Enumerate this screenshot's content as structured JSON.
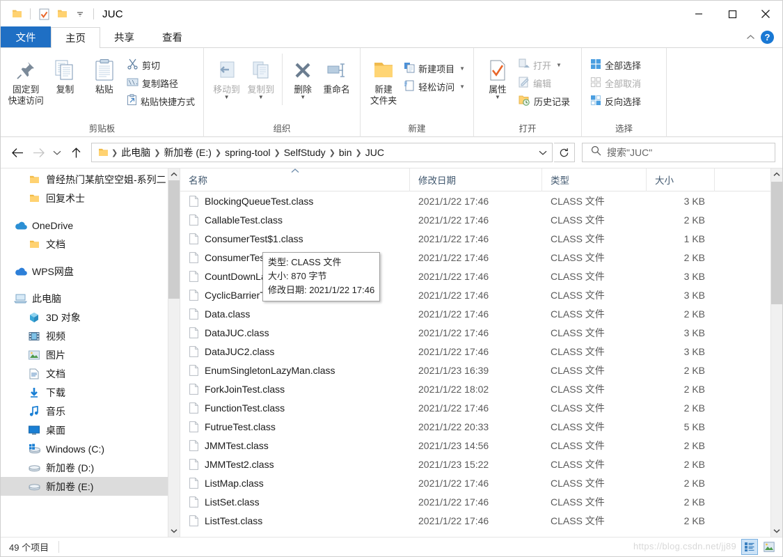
{
  "window": {
    "title": "JUC",
    "quick_access": [
      "folder-icon",
      "properties-check-icon",
      "new-folder-icon",
      "customize-dropdown-icon"
    ],
    "controls": {
      "minimize": "minimize-icon",
      "maximize": "maximize-icon",
      "close": "close-icon"
    }
  },
  "tabs": {
    "file": "文件",
    "items": [
      {
        "label": "主页",
        "active": true
      },
      {
        "label": "共享",
        "active": false
      },
      {
        "label": "查看",
        "active": false
      }
    ],
    "collapse_icon": "chevron-up-icon",
    "help_icon": "help-icon"
  },
  "ribbon": {
    "groups": [
      {
        "label": "剪贴板",
        "big": [
          {
            "label": "固定到\n快速访问",
            "line1": "固定到",
            "line2": "快速访问",
            "icon": "pin-icon"
          },
          {
            "label": "复制",
            "icon": "copy-icon"
          },
          {
            "label": "粘贴",
            "icon": "paste-icon"
          }
        ],
        "small": [
          {
            "label": "剪切",
            "icon": "scissors-icon",
            "dim": false
          },
          {
            "label": "复制路径",
            "icon": "copy-path-icon",
            "dim": false
          },
          {
            "label": "粘贴快捷方式",
            "icon": "paste-shortcut-icon",
            "dim": false
          }
        ]
      },
      {
        "label": "组织",
        "big": [
          {
            "label": "移动到",
            "icon": "move-to-icon",
            "dim": true,
            "dropdown": true
          },
          {
            "label": "复制到",
            "icon": "copy-to-icon",
            "dim": true,
            "dropdown": true
          },
          {
            "label": "删除",
            "icon": "delete-x-icon",
            "dropdown": true
          },
          {
            "label": "重命名",
            "icon": "rename-icon"
          }
        ],
        "small": []
      },
      {
        "label": "新建",
        "big": [
          {
            "line1": "新建",
            "line2": "文件夹",
            "label": "新建文件夹",
            "icon": "new-folder-icon"
          }
        ],
        "small": [
          {
            "label": "新建项目",
            "icon": "new-item-icon",
            "dropdown": true
          },
          {
            "label": "轻松访问",
            "icon": "easy-access-icon",
            "dropdown": true
          }
        ]
      },
      {
        "label": "打开",
        "big": [
          {
            "label": "属性",
            "icon": "properties-icon",
            "dropdown": true
          }
        ],
        "small": [
          {
            "label": "打开",
            "icon": "open-icon",
            "dim": true,
            "dropdown": true
          },
          {
            "label": "编辑",
            "icon": "edit-icon",
            "dim": true
          },
          {
            "label": "历史记录",
            "icon": "history-icon"
          }
        ]
      },
      {
        "label": "选择",
        "big": [],
        "small": [
          {
            "label": "全部选择",
            "icon": "select-all-icon"
          },
          {
            "label": "全部取消",
            "icon": "select-none-icon",
            "dim": true
          },
          {
            "label": "反向选择",
            "icon": "invert-selection-icon"
          }
        ]
      }
    ]
  },
  "addressbar": {
    "back_icon": "arrow-left-icon",
    "forward_icon": "arrow-right-icon",
    "recent_icon": "chevron-down-icon",
    "up_icon": "arrow-up-icon",
    "folder_icon": "folder-icon",
    "crumbs": [
      "此电脑",
      "新加卷 (E:)",
      "spring-tool",
      "SelfStudy",
      "bin",
      "JUC"
    ],
    "dropdown_icon": "chevron-down-icon",
    "refresh_icon": "refresh-icon",
    "search_icon": "search-icon",
    "search_placeholder": "搜索\"JUC\""
  },
  "sidebar": {
    "items": [
      {
        "label": "曾经热门某航空空姐-系列二",
        "icon": "folder-icon",
        "level": 2,
        "gap_after": false
      },
      {
        "label": "回复术士",
        "icon": "folder-icon",
        "level": 2,
        "gap_after": true
      },
      {
        "label": "OneDrive",
        "icon": "onedrive-icon",
        "level": 1,
        "gap_after": false
      },
      {
        "label": "文档",
        "icon": "folder-icon",
        "level": 2,
        "gap_after": true
      },
      {
        "label": "WPS网盘",
        "icon": "wps-cloud-icon",
        "level": 1,
        "gap_after": true
      },
      {
        "label": "此电脑",
        "icon": "this-pc-icon",
        "level": 1,
        "gap_after": false
      },
      {
        "label": "3D 对象",
        "icon": "3d-objects-icon",
        "level": 2,
        "gap_after": false
      },
      {
        "label": "视频",
        "icon": "videos-icon",
        "level": 2,
        "gap_after": false
      },
      {
        "label": "图片",
        "icon": "pictures-icon",
        "level": 2,
        "gap_after": false
      },
      {
        "label": "文档",
        "icon": "documents-icon",
        "level": 2,
        "gap_after": false
      },
      {
        "label": "下载",
        "icon": "downloads-icon",
        "level": 2,
        "gap_after": false
      },
      {
        "label": "音乐",
        "icon": "music-icon",
        "level": 2,
        "gap_after": false
      },
      {
        "label": "桌面",
        "icon": "desktop-icon",
        "level": 2,
        "gap_after": false
      },
      {
        "label": "Windows (C:)",
        "icon": "windows-drive-icon",
        "level": 2,
        "gap_after": false
      },
      {
        "label": "新加卷 (D:)",
        "icon": "drive-icon",
        "level": 2,
        "gap_after": false
      },
      {
        "label": "新加卷 (E:)",
        "icon": "drive-icon",
        "level": 2,
        "gap_after": false,
        "selected": true
      }
    ],
    "scroll_up_icon": "chevron-up-icon",
    "scroll_down_icon": "chevron-down-icon"
  },
  "filelist": {
    "columns": [
      {
        "label": "名称",
        "sorted": true,
        "sort_icon": "sort-asc-icon"
      },
      {
        "label": "修改日期",
        "sorted": false
      },
      {
        "label": "类型",
        "sorted": false
      },
      {
        "label": "大小",
        "sorted": false
      }
    ],
    "rows": [
      {
        "name": "BlockingQueueTest.class",
        "date": "2021/1/22 17:46",
        "type": "CLASS 文件",
        "size": "3 KB"
      },
      {
        "name": "CallableTest.class",
        "date": "2021/1/22 17:46",
        "type": "CLASS 文件",
        "size": "2 KB"
      },
      {
        "name": "ConsumerTest$1.class",
        "date": "2021/1/22 17:46",
        "type": "CLASS 文件",
        "size": "1 KB"
      },
      {
        "name": "ConsumerTest.class",
        "date": "2021/1/22 17:46",
        "type": "CLASS 文件",
        "size": "2 KB"
      },
      {
        "name": "CountDownLatchTest.class",
        "date": "2021/1/22 17:46",
        "type": "CLASS 文件",
        "size": "3 KB"
      },
      {
        "name": "CyclicBarrierTest.class",
        "date": "2021/1/22 17:46",
        "type": "CLASS 文件",
        "size": "3 KB"
      },
      {
        "name": "Data.class",
        "date": "2021/1/22 17:46",
        "type": "CLASS 文件",
        "size": "2 KB"
      },
      {
        "name": "DataJUC.class",
        "date": "2021/1/22 17:46",
        "type": "CLASS 文件",
        "size": "3 KB"
      },
      {
        "name": "DataJUC2.class",
        "date": "2021/1/22 17:46",
        "type": "CLASS 文件",
        "size": "3 KB"
      },
      {
        "name": "EnumSingletonLazyMan.class",
        "date": "2021/1/23 16:39",
        "type": "CLASS 文件",
        "size": "2 KB"
      },
      {
        "name": "ForkJoinTest.class",
        "date": "2021/1/22 18:02",
        "type": "CLASS 文件",
        "size": "2 KB"
      },
      {
        "name": "FunctionTest.class",
        "date": "2021/1/22 17:46",
        "type": "CLASS 文件",
        "size": "2 KB"
      },
      {
        "name": "FutrueTest.class",
        "date": "2021/1/22 20:33",
        "type": "CLASS 文件",
        "size": "5 KB"
      },
      {
        "name": "JMMTest.class",
        "date": "2021/1/23 14:56",
        "type": "CLASS 文件",
        "size": "2 KB"
      },
      {
        "name": "JMMTest2.class",
        "date": "2021/1/23 15:22",
        "type": "CLASS 文件",
        "size": "2 KB"
      },
      {
        "name": "ListMap.class",
        "date": "2021/1/22 17:46",
        "type": "CLASS 文件",
        "size": "2 KB"
      },
      {
        "name": "ListSet.class",
        "date": "2021/1/22 17:46",
        "type": "CLASS 文件",
        "size": "2 KB"
      },
      {
        "name": "ListTest.class",
        "date": "2021/1/22 17:46",
        "type": "CLASS 文件",
        "size": "2 KB"
      }
    ],
    "scroll_up_icon": "chevron-up-icon",
    "scroll_down_icon": "chevron-down-icon"
  },
  "tooltip": {
    "line1": "类型: CLASS 文件",
    "line2": "大小: 870 字节",
    "line3": "修改日期: 2021/1/22 17:46"
  },
  "statusbar": {
    "count": "49 个项目",
    "watermark": "https://blog.csdn.net/jj89",
    "view_details_icon": "details-view-icon",
    "view_large_icon": "large-icons-view-icon"
  },
  "colors": {
    "accent": "#1f6fc4",
    "folder_yellow": "#ffca5f",
    "selection": "#dcdcdc"
  }
}
